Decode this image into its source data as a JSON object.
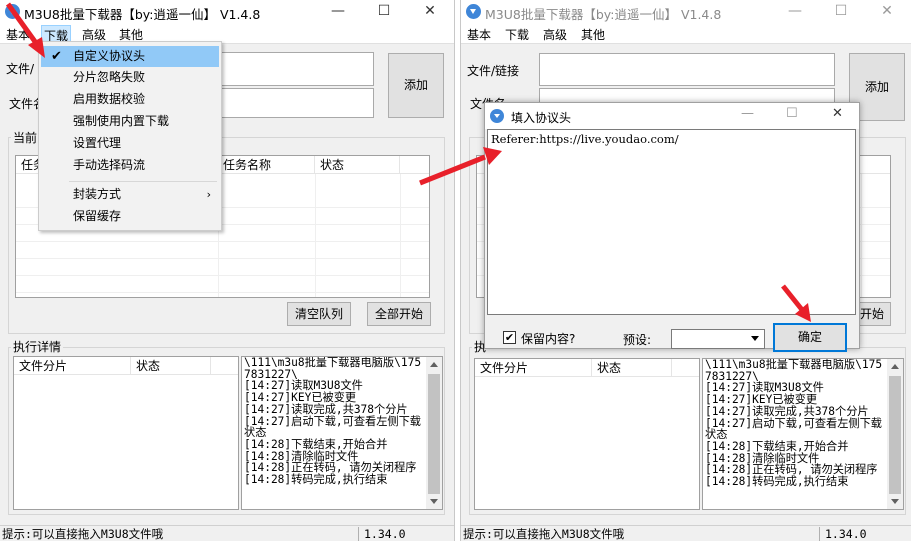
{
  "app": {
    "title": "M3U8批量下载器【by:逍遥一仙】 V1.4.8",
    "minimize": "—",
    "maximize": "☐",
    "close": "✕"
  },
  "menu": {
    "items": [
      "基本",
      "下载",
      "高级",
      "其他"
    ]
  },
  "form": {
    "file_label_left": "文件/",
    "file_label_right": "文件/链接",
    "name_label_left": "文件名",
    "name_label_right": "文件名",
    "add_button": "添加"
  },
  "queue": {
    "group_title": "当前",
    "col_task": "任务",
    "col_task_name": "任务名称",
    "col_status": "状态",
    "clear_button": "清空队列",
    "start_all_button": "全部开始",
    "start_all_partial": "开始"
  },
  "details": {
    "group_title": "执行详情",
    "group_title_partial": "执",
    "col_file_segment": "文件分片",
    "col_status": "状态",
    "log": "\\111\\m3u8批量下载器电脑版\\1757831227\\\n[14:27]读取M3U8文件\n[14:27]KEY已被变更\n[14:27]读取完成,共378个分片\n[14:27]启动下载,可查看左侧下载状态\n[14:28]下载结束,开始合并\n[14:28]清除临时文件\n[14:28]正在转码, 请勿关闭程序\n[14:28]转码完成,执行结束"
  },
  "status_bar": {
    "hint": "提示:可以直接拖入M3U8文件哦",
    "version": "1.34.0"
  },
  "download_menu": {
    "items": [
      {
        "label": "自定义协议头",
        "checked": true,
        "submenu": false
      },
      {
        "label": "分片忽略失败",
        "checked": false,
        "submenu": false
      },
      {
        "label": "启用数据校验",
        "checked": false,
        "submenu": false
      },
      {
        "label": "强制使用内置下载",
        "checked": false,
        "submenu": false
      },
      {
        "label": "设置代理",
        "checked": false,
        "submenu": false
      },
      {
        "label": "手动选择码流",
        "checked": false,
        "submenu": false
      },
      {
        "label": "封装方式",
        "checked": false,
        "submenu": true
      },
      {
        "label": "保留缓存",
        "checked": false,
        "submenu": false
      }
    ],
    "check_mark": "✔",
    "submenu_arrow": "›"
  },
  "header_dialog": {
    "title": "填入协议头",
    "content": "Referer:https://live.youdao.com/",
    "keep_label": "保留内容?",
    "keep_checked": "✔",
    "preset_label": "预设:",
    "ok_button": "确定"
  },
  "colors": {
    "arrow_red": "#e8202a",
    "menu_highlight": "#91c9f7",
    "icon_blue": "#3f86d8"
  }
}
